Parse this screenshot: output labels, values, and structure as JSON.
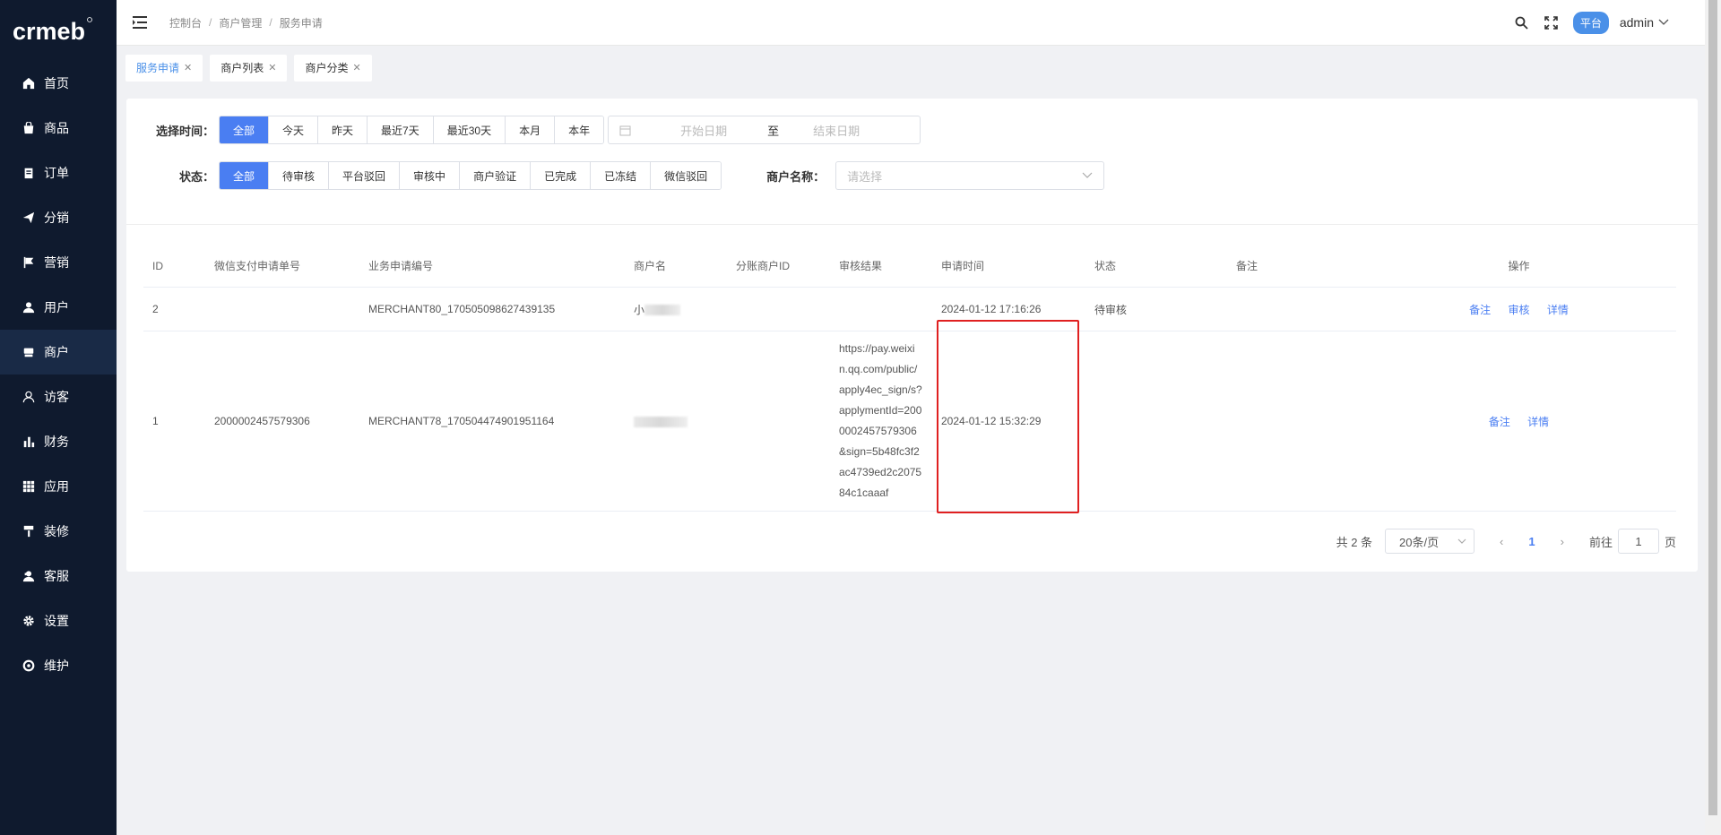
{
  "logo_text": "crmeb",
  "sidebar": {
    "items": [
      {
        "label": "首页",
        "icon": "home-icon"
      },
      {
        "label": "商品",
        "icon": "bag-icon"
      },
      {
        "label": "订单",
        "icon": "clipboard-icon"
      },
      {
        "label": "分销",
        "icon": "send-icon"
      },
      {
        "label": "营销",
        "icon": "flag-icon"
      },
      {
        "label": "用户",
        "icon": "user-icon"
      },
      {
        "label": "商户",
        "icon": "store-icon",
        "active": true
      },
      {
        "label": "访客",
        "icon": "visitor-icon"
      },
      {
        "label": "财务",
        "icon": "bar-chart-icon"
      },
      {
        "label": "应用",
        "icon": "grid-icon"
      },
      {
        "label": "装修",
        "icon": "paint-roller-icon"
      },
      {
        "label": "客服",
        "icon": "support-icon"
      },
      {
        "label": "设置",
        "icon": "gear-icon"
      },
      {
        "label": "维护",
        "icon": "lifebuoy-icon"
      }
    ]
  },
  "header": {
    "breadcrumb": [
      "控制台",
      "商户管理",
      "服务申请"
    ],
    "platform_badge": "平台",
    "user": "admin"
  },
  "tabs": [
    {
      "label": "服务申请",
      "active": true
    },
    {
      "label": "商户列表"
    },
    {
      "label": "商户分类"
    }
  ],
  "filters": {
    "time_label": "选择时间：",
    "time_options": [
      "全部",
      "今天",
      "昨天",
      "最近7天",
      "最近30天",
      "本月",
      "本年"
    ],
    "time_selected": "全部",
    "date_start_placeholder": "开始日期",
    "date_sep": "至",
    "date_end_placeholder": "结束日期",
    "status_label": "状态：",
    "status_options": [
      "全部",
      "待审核",
      "平台驳回",
      "审核中",
      "商户验证",
      "已完成",
      "已冻结",
      "微信驳回"
    ],
    "status_selected": "全部",
    "merchant_label": "商户名称：",
    "merchant_placeholder": "请选择"
  },
  "table": {
    "columns": [
      "ID",
      "微信支付申请单号",
      "业务申请编号",
      "商户名",
      "分账商户ID",
      "审核结果",
      "申请时间",
      "状态",
      "备注",
      "操作"
    ],
    "rows": [
      {
        "id": "2",
        "wx_no": "",
        "biz_no": "MERCHANT80_170505098627439135",
        "merchant": "小",
        "sub_id": "",
        "result": [],
        "time": "2024-01-12 17:16:26",
        "status": "待审核",
        "remark": "",
        "actions": [
          "备注",
          "审核",
          "详情"
        ]
      },
      {
        "id": "1",
        "wx_no": "2000002457579306",
        "biz_no": "MERCHANT78_170504474901951164",
        "merchant": "",
        "sub_id": "",
        "result": [
          "https://pay.weixi",
          "n.qq.com/public/",
          "apply4ec_sign/s?",
          "applymentId=200",
          "0002457579306",
          "&sign=5b48fc3f2",
          "ac4739ed2c2075",
          "84c1caaaf"
        ],
        "time": "2024-01-12 15:32:29",
        "status": "",
        "remark": "",
        "actions": [
          "备注",
          "详情"
        ]
      }
    ]
  },
  "pagination": {
    "total": "共 2 条",
    "page_size": "20条/页",
    "current": "1",
    "goto_label": "前往",
    "goto_value": "1",
    "page_suffix": "页"
  }
}
